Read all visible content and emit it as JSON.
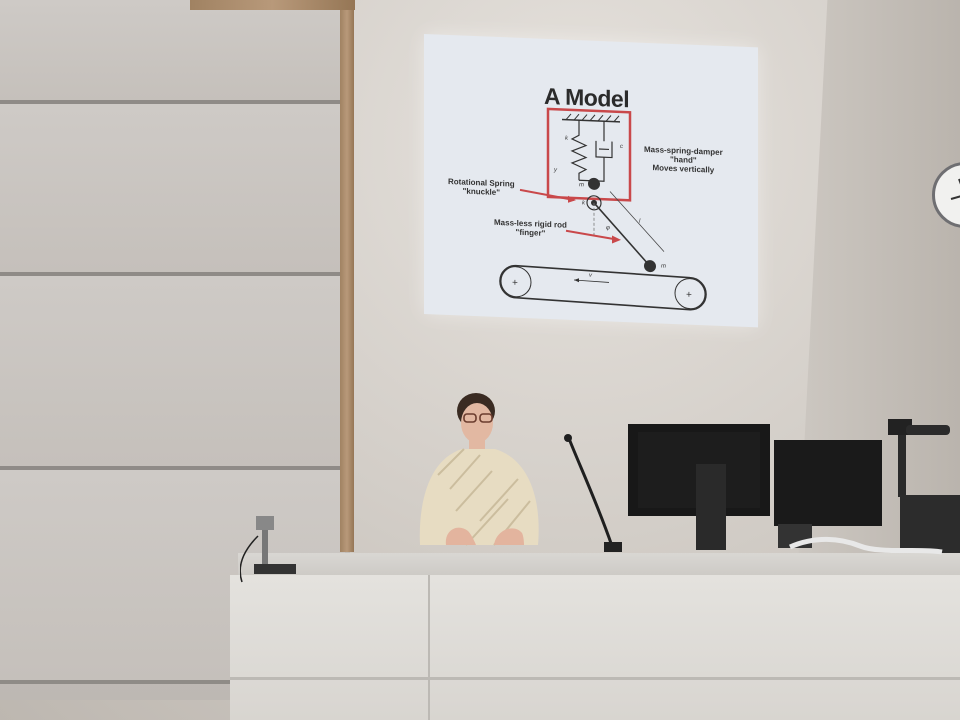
{
  "slide": {
    "title": "A Model",
    "labels": {
      "msd": [
        "Mass-spring-damper",
        "\"hand\"",
        "Moves vertically"
      ],
      "rotational": [
        "Rotational Spring",
        "\"knuckle\""
      ],
      "rod": [
        "Mass-less rigid rod",
        "\"finger\""
      ]
    },
    "symbols": {
      "k": "k",
      "c": "c",
      "y": "y",
      "mh": "m",
      "kf": "k",
      "l": "l",
      "phi": "φ",
      "mf": "m",
      "vb": "v"
    }
  },
  "colors": {
    "slide_red": "#c9484a",
    "wall": "#d4cfc9",
    "sweater": "#e7dcc2"
  }
}
